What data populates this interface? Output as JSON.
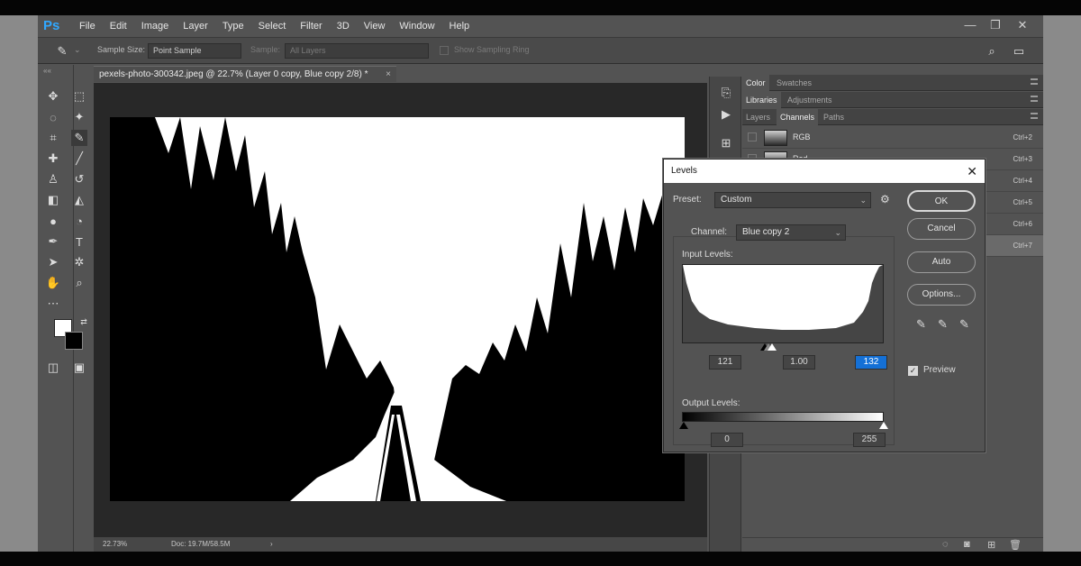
{
  "app": {
    "logo": "Ps",
    "menu": [
      "File",
      "Edit",
      "Image",
      "Layer",
      "Type",
      "Select",
      "Filter",
      "3D",
      "View",
      "Window",
      "Help"
    ],
    "window_controls": [
      "—",
      "❐",
      "✕"
    ]
  },
  "options_bar": {
    "sample_size_label": "Sample Size:",
    "sample_size_value": "Point Sample",
    "sample_label": "Sample:",
    "sample_value": "All Layers",
    "show_ring_label": "Show Sampling Ring"
  },
  "document": {
    "tab_title": "pexels-photo-300342.jpeg @ 22.7% (Layer 0 copy, Blue copy 2/8) *",
    "tab_close": "×"
  },
  "status_bar": {
    "zoom": "22.73%",
    "doc_info": "Doc: 19.7M/58.5M",
    "arrow": "›"
  },
  "panels": {
    "group1_tabs": [
      "Color",
      "Swatches"
    ],
    "group2_tabs": [
      "Libraries",
      "Adjustments"
    ],
    "group3_tabs": [
      "Layers",
      "Channels",
      "Paths"
    ],
    "channels": [
      {
        "name": "RGB",
        "shortcut": "Ctrl+2"
      },
      {
        "name": "Red",
        "shortcut": "Ctrl+3"
      },
      {
        "name": "",
        "shortcut": "Ctrl+4"
      },
      {
        "name": "",
        "shortcut": "Ctrl+5"
      },
      {
        "name": "",
        "shortcut": "Ctrl+6"
      },
      {
        "name": "",
        "shortcut": "Ctrl+7"
      }
    ]
  },
  "levels": {
    "title": "Levels",
    "close": "✕",
    "preset_label": "Preset:",
    "preset_value": "Custom",
    "channel_label": "Channel:",
    "channel_value": "Blue copy 2",
    "input_label": "Input Levels:",
    "input_black": "121",
    "input_gamma": "1.00",
    "input_white": "132",
    "output_label": "Output Levels:",
    "output_black": "0",
    "output_white": "255",
    "buttons": {
      "ok": "OK",
      "cancel": "Cancel",
      "auto": "Auto",
      "options": "Options..."
    },
    "preview_label": "Preview",
    "preview_checked": "✓"
  },
  "colors": {
    "ui_bg": "#535353",
    "canvas_bg": "#282828",
    "accent": "#31a8ff",
    "highlight": "#1470d6"
  }
}
